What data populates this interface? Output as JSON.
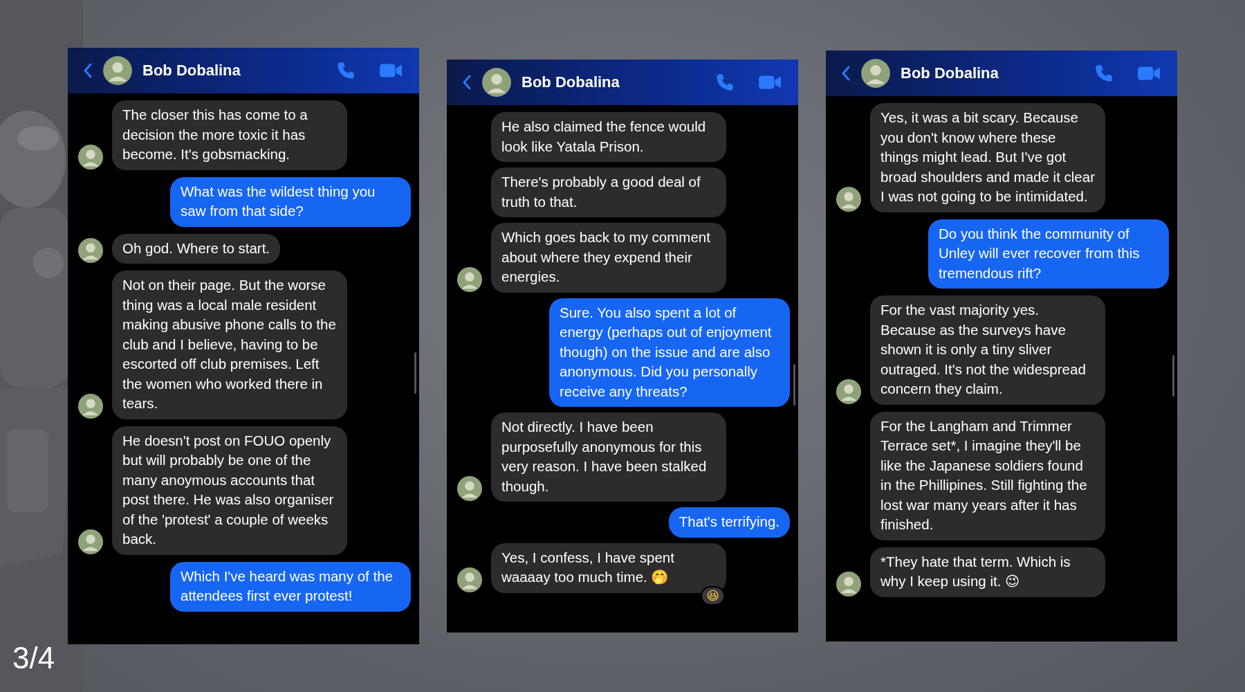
{
  "slide_counter": "3/4",
  "chats": [
    {
      "contact": "Bob Dobalina",
      "messages": [
        {
          "kind": "incoming",
          "avatar": true,
          "text": "The closer this has come to a decision the more toxic it has become. It's gobsmacking."
        },
        {
          "kind": "outgoing",
          "text": "What was the wildest thing you saw from that side?"
        },
        {
          "kind": "incoming",
          "avatar": true,
          "text": "Oh god. Where to start."
        },
        {
          "kind": "incoming",
          "avatar": true,
          "text": "Not on their page. But the worse thing was a local male resident making abusive phone calls to the club and I believe, having to be escorted off club premises. Left the women who worked there in tears."
        },
        {
          "kind": "incoming",
          "avatar": true,
          "text": "He doesn't post on FOUO openly but will probably be one of the many anoymous accounts that post there. He was also organiser of the 'protest' a couple of weeks back."
        },
        {
          "kind": "outgoing",
          "text": "Which I've heard was many of the attendees first ever protest!"
        }
      ]
    },
    {
      "contact": "Bob Dobalina",
      "messages": [
        {
          "kind": "incoming",
          "avatar": false,
          "text": "He also claimed the fence would look like Yatala Prison."
        },
        {
          "kind": "incoming",
          "avatar": false,
          "text": "There's probably a good deal of truth to that."
        },
        {
          "kind": "incoming",
          "avatar": true,
          "text": "Which goes back to my comment about where they expend their energies."
        },
        {
          "kind": "outgoing",
          "text": "Sure. You also spent a lot of energy (perhaps out of enjoyment though) on the issue and are also anonymous. Did you personally receive any threats?"
        },
        {
          "kind": "incoming",
          "avatar": true,
          "text": "Not directly. I have been purposefully anonymous for this very reason. I have been stalked though."
        },
        {
          "kind": "outgoing",
          "text": "That's terrifying."
        },
        {
          "kind": "incoming",
          "avatar": true,
          "text": "Yes, I confess, I have spent waaaay too much time. 🤭",
          "reaction": "😆"
        }
      ]
    },
    {
      "contact": "Bob Dobalina",
      "messages": [
        {
          "kind": "incoming",
          "avatar": true,
          "text": "Yes, it was a bit scary. Because you don't know where these things might lead. But I've got broad shoulders and made it clear I was not going to be intimidated."
        },
        {
          "kind": "outgoing",
          "text": "Do you think the community of Unley will ever recover from this tremendous rift?"
        },
        {
          "kind": "incoming",
          "avatar": true,
          "text": "For the vast majority yes. Because as the surveys have shown it is only a tiny sliver outraged. It's not the widespread concern they claim."
        },
        {
          "kind": "incoming",
          "avatar": false,
          "text": "For the Langham and Trimmer Terrace set*, I imagine they'll be like the Japanese soldiers found in the Phillipines. Still fighting the lost war many years after it has finished."
        },
        {
          "kind": "incoming",
          "avatar": true,
          "text": "*They hate that term. Which is why I keep using it. 😉"
        }
      ]
    }
  ]
}
